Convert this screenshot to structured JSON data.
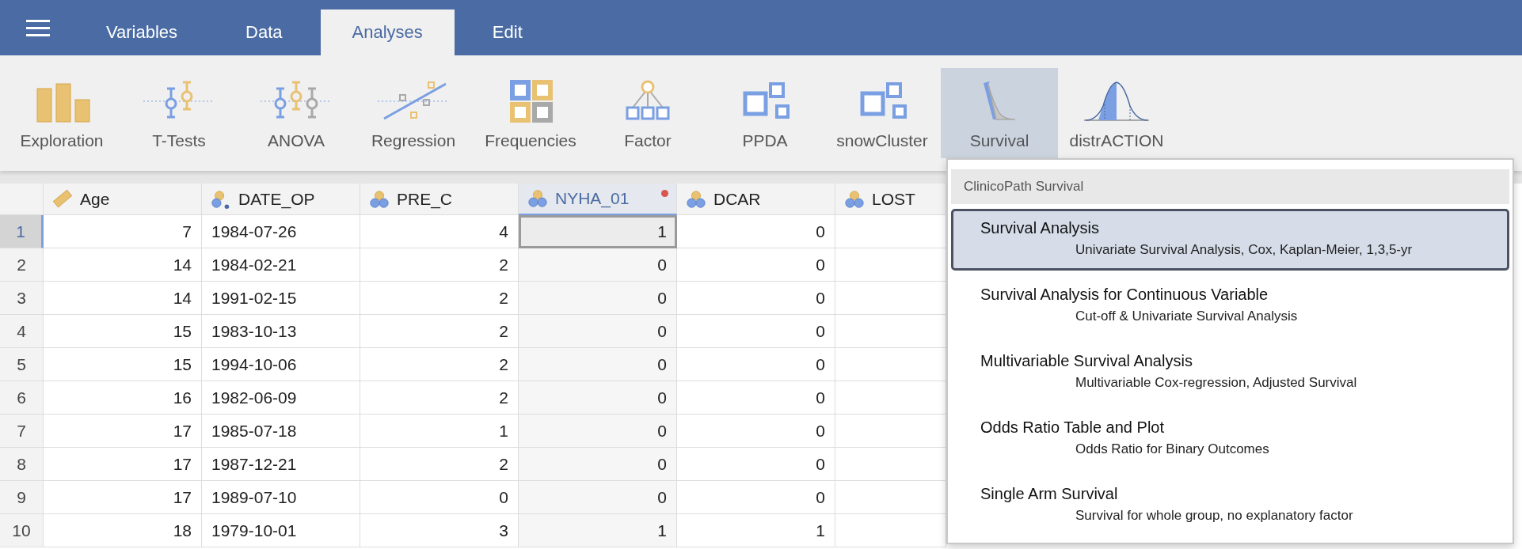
{
  "menu_bar": {
    "tabs": [
      {
        "label": "Variables",
        "selected": false
      },
      {
        "label": "Data",
        "selected": false
      },
      {
        "label": "Analyses",
        "selected": true
      },
      {
        "label": "Edit",
        "selected": false
      }
    ]
  },
  "toolbar": {
    "items": [
      {
        "label": "Exploration",
        "kind": "bars",
        "selected": false
      },
      {
        "label": "T-Tests",
        "kind": "ttest",
        "selected": false
      },
      {
        "label": "ANOVA",
        "kind": "anova",
        "selected": false
      },
      {
        "label": "Regression",
        "kind": "regression",
        "selected": false
      },
      {
        "label": "Frequencies",
        "kind": "frequencies",
        "selected": false
      },
      {
        "label": "Factor",
        "kind": "factor",
        "selected": false
      },
      {
        "label": "PPDA",
        "kind": "squares",
        "selected": false
      },
      {
        "label": "snowCluster",
        "kind": "squares",
        "selected": false
      },
      {
        "label": "Survival",
        "kind": "survival",
        "selected": true
      },
      {
        "label": "distrACTION",
        "kind": "distribution",
        "selected": false
      }
    ]
  },
  "table": {
    "columns": [
      {
        "name": "Age",
        "kind": "continuous",
        "selected": false,
        "modified": false
      },
      {
        "name": "DATE_OP",
        "kind": "text",
        "selected": false,
        "modified": false
      },
      {
        "name": "PRE_C",
        "kind": "nominal",
        "selected": false,
        "modified": false
      },
      {
        "name": "NYHA_01",
        "kind": "nominal",
        "selected": true,
        "modified": true
      },
      {
        "name": "DCAR",
        "kind": "nominal",
        "selected": false,
        "modified": false
      },
      {
        "name": "LOST",
        "kind": "nominal",
        "selected": false,
        "modified": false
      }
    ],
    "rows": [
      {
        "number": "1",
        "selected": true,
        "cells": [
          "7",
          "1984-07-26",
          "4",
          "1",
          "0"
        ]
      },
      {
        "number": "2",
        "selected": false,
        "cells": [
          "14",
          "1984-02-21",
          "2",
          "0",
          "0"
        ]
      },
      {
        "number": "3",
        "selected": false,
        "cells": [
          "14",
          "1991-02-15",
          "2",
          "0",
          "0"
        ]
      },
      {
        "number": "4",
        "selected": false,
        "cells": [
          "15",
          "1983-10-13",
          "2",
          "0",
          "0"
        ]
      },
      {
        "number": "5",
        "selected": false,
        "cells": [
          "15",
          "1994-10-06",
          "2",
          "0",
          "0"
        ]
      },
      {
        "number": "6",
        "selected": false,
        "cells": [
          "16",
          "1982-06-09",
          "2",
          "0",
          "0"
        ]
      },
      {
        "number": "7",
        "selected": false,
        "cells": [
          "17",
          "1985-07-18",
          "1",
          "0",
          "0"
        ]
      },
      {
        "number": "8",
        "selected": false,
        "cells": [
          "17",
          "1987-12-21",
          "2",
          "0",
          "0"
        ]
      },
      {
        "number": "9",
        "selected": false,
        "cells": [
          "17",
          "1989-07-10",
          "0",
          "0",
          "0"
        ]
      },
      {
        "number": "10",
        "selected": false,
        "cells": [
          "18",
          "1979-10-01",
          "3",
          "1",
          "1"
        ]
      }
    ]
  },
  "analysis_menu": {
    "heading": "ClinicoPath Survival",
    "items": [
      {
        "title": "Survival Analysis",
        "description": "Univariate Survival Analysis, Cox, Kaplan-Meier, 1,3,5-yr",
        "selected": true
      },
      {
        "title": "Survival Analysis for Continuous Variable",
        "description": "Cut-off & Univariate Survival Analysis",
        "selected": false
      },
      {
        "title": "Multivariable Survival Analysis",
        "description": "Multivariable Cox-regression, Adjusted Survival",
        "selected": false
      },
      {
        "title": "Odds Ratio Table and Plot",
        "description": "Odds Ratio for Binary Outcomes",
        "selected": false
      },
      {
        "title": "Single Arm Survival",
        "description": "Survival for whole group, no explanatory factor",
        "selected": false
      }
    ]
  }
}
